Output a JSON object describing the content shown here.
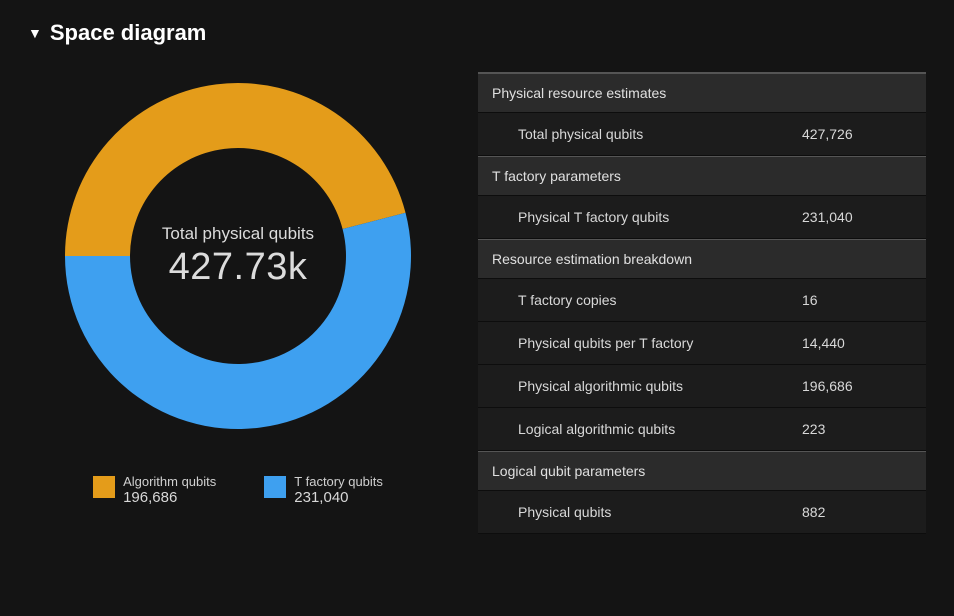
{
  "header": {
    "title": "Space diagram",
    "disclosure_icon": "▼"
  },
  "chart_data": {
    "type": "pie",
    "title": "Total physical qubits",
    "center_value": "427.73k",
    "series": [
      {
        "name": "Algorithm qubits",
        "value": 196686,
        "color": "#e49c1a"
      },
      {
        "name": "T factory qubits",
        "value": 231040,
        "color": "#3ea0f0"
      }
    ],
    "legend_position": "bottom"
  },
  "legend": [
    {
      "label": "Algorithm qubits",
      "value": "196,686",
      "color": "#e49c1a"
    },
    {
      "label": "T factory qubits",
      "value": "231,040",
      "color": "#3ea0f0"
    }
  ],
  "table": {
    "sections": [
      {
        "title": "Physical resource estimates",
        "rows": [
          {
            "k": "Total physical qubits",
            "v": "427,726"
          }
        ]
      },
      {
        "title": "T factory parameters",
        "rows": [
          {
            "k": "Physical T factory qubits",
            "v": "231,040"
          }
        ]
      },
      {
        "title": "Resource estimation breakdown",
        "rows": [
          {
            "k": "T factory copies",
            "v": "16"
          },
          {
            "k": "Physical qubits per T factory",
            "v": "14,440"
          },
          {
            "k": "Physical algorithmic qubits",
            "v": "196,686"
          },
          {
            "k": "Logical algorithmic qubits",
            "v": "223"
          }
        ]
      },
      {
        "title": "Logical qubit parameters",
        "rows": [
          {
            "k": "Physical qubits",
            "v": "882"
          }
        ]
      }
    ]
  }
}
